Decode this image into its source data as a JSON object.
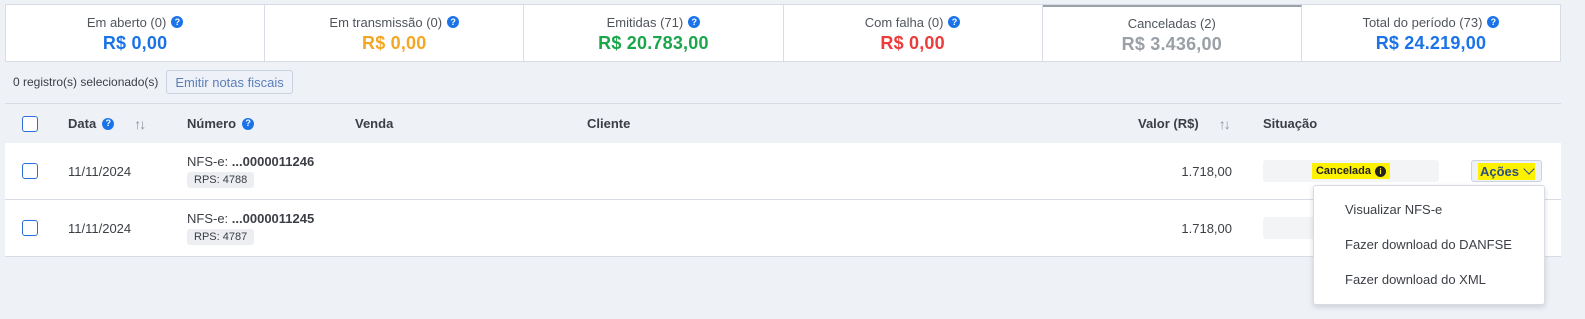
{
  "summary": [
    {
      "label": "Em aberto (0)",
      "value": "R$ 0,00",
      "color": "#1a73e8"
    },
    {
      "label": "Em transmissão (0)",
      "value": "R$ 0,00",
      "color": "#f5a623"
    },
    {
      "label": "Emitidas (71)",
      "value": "R$ 20.783,00",
      "color": "#1aa64a"
    },
    {
      "label": "Com falha (0)",
      "value": "R$ 0,00",
      "color": "#ec3b3b"
    },
    {
      "label": "Canceladas (2)",
      "value": "R$ 3.436,00",
      "color": "#9aa0a6"
    },
    {
      "label": "Total do período (73)",
      "value": "R$ 24.219,00",
      "color": "#1a73e8"
    }
  ],
  "toolbar": {
    "selected_count": "0 registro(s) selecionado(s)",
    "emit_button": "Emitir notas fiscais"
  },
  "table": {
    "headers": {
      "data": "Data",
      "numero": "Número",
      "venda": "Venda",
      "cliente": "Cliente",
      "valor": "Valor (R$)",
      "situacao": "Situação"
    },
    "rows": [
      {
        "date": "11/11/2024",
        "nfse_prefix": "NFS-e: ",
        "nfse_number": "...0000011246",
        "rps": "RPS: 4788",
        "value": "1.718,00",
        "status": "Cancelada",
        "actions": "Ações"
      },
      {
        "date": "11/11/2024",
        "nfse_prefix": "NFS-e: ",
        "nfse_number": "...0000011245",
        "rps": "RPS: 4787",
        "value": "1.718,00",
        "status": "",
        "actions": ""
      }
    ]
  },
  "actions_menu": {
    "items": [
      "Visualizar NFS-e",
      "Fazer download do DANFSE",
      "Fazer download do XML"
    ]
  },
  "icons": {
    "help": "question-circle-icon",
    "sort": "sort-arrows-icon",
    "info": "info-circle-icon",
    "chevron": "chevron-down-icon"
  }
}
